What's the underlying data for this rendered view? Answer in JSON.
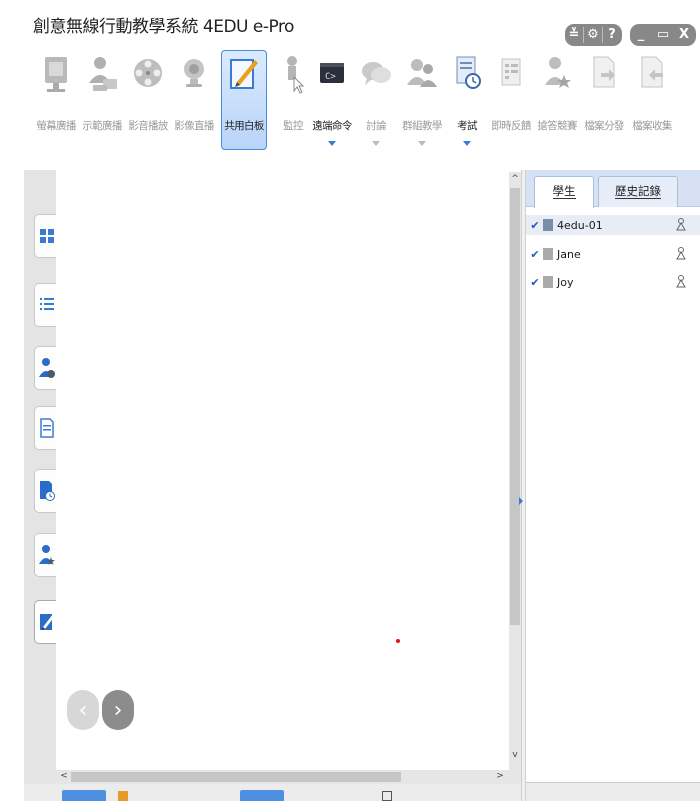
{
  "app": {
    "title": "創意無線行動教學系統 4EDU e-Pro"
  },
  "window_controls": {
    "group1": [
      "≚",
      "⚙",
      "?"
    ],
    "group2": [
      "_",
      "▭",
      "X"
    ]
  },
  "toolbar": {
    "tools": [
      {
        "label": "螢幕廣播",
        "icon": "screen-broadcast-icon"
      },
      {
        "label": "示範廣播",
        "icon": "demo-broadcast-icon"
      },
      {
        "label": "影音播放",
        "icon": "film-reel-icon"
      },
      {
        "label": "影像直播",
        "icon": "webcam-icon"
      },
      {
        "label": "共用白板",
        "icon": "whiteboard-icon",
        "active": true
      },
      {
        "label": "監控",
        "icon": "monitor-control-icon"
      },
      {
        "label": "遠端命令",
        "icon": "remote-command-icon",
        "enabled": true,
        "dropdown": true
      },
      {
        "label": "討論",
        "icon": "discussion-icon",
        "dropdown": true
      },
      {
        "label": "群組教學",
        "icon": "group-teaching-icon",
        "dropdown": true
      },
      {
        "label": "考試",
        "icon": "exam-icon",
        "enabled": true,
        "dropdown": true
      },
      {
        "label": "即時反饋",
        "icon": "feedback-icon"
      },
      {
        "label": "搶答競賽",
        "icon": "quiz-competition-icon"
      },
      {
        "label": "檔案分發",
        "icon": "file-distribute-icon"
      },
      {
        "label": "檔案收集",
        "icon": "file-collect-icon"
      }
    ]
  },
  "left_rail": {
    "tabs": [
      {
        "icon": "grid-view-icon"
      },
      {
        "icon": "list-view-icon"
      },
      {
        "icon": "student-add-icon"
      },
      {
        "icon": "document-icon"
      },
      {
        "icon": "document-clock-icon"
      },
      {
        "icon": "user-star-icon"
      },
      {
        "icon": "whiteboard-pen-icon",
        "selected": true
      }
    ]
  },
  "whiteboard": {
    "prev_label": "‹",
    "next_label": "›"
  },
  "scrollbars": {
    "up": "^",
    "down": "v",
    "left": "<",
    "right": ">"
  },
  "right_panel": {
    "tabs": [
      "學生",
      "歷史記錄"
    ],
    "students": [
      {
        "name": "4edu-01",
        "checked": true,
        "avatar": "user-photo-icon"
      },
      {
        "name": "Jane",
        "checked": true,
        "avatar": "user-placeholder-icon"
      },
      {
        "name": "Joy",
        "checked": true,
        "avatar": "user-placeholder-icon"
      }
    ],
    "checkmark": "✔"
  },
  "colors": {
    "accent": "#3a7bd5",
    "active_tool_bg": "#b8d4f8",
    "panel_header": "#d6e2f4",
    "red_marker": "#e3121b"
  }
}
